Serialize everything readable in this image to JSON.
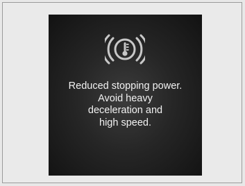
{
  "warning": {
    "icon": "brake-temperature-warning-icon",
    "icon_color": "#c8c8c8",
    "message_lines": [
      "Reduced stopping power.",
      "Avoid heavy",
      "deceleration and",
      "high speed."
    ]
  }
}
